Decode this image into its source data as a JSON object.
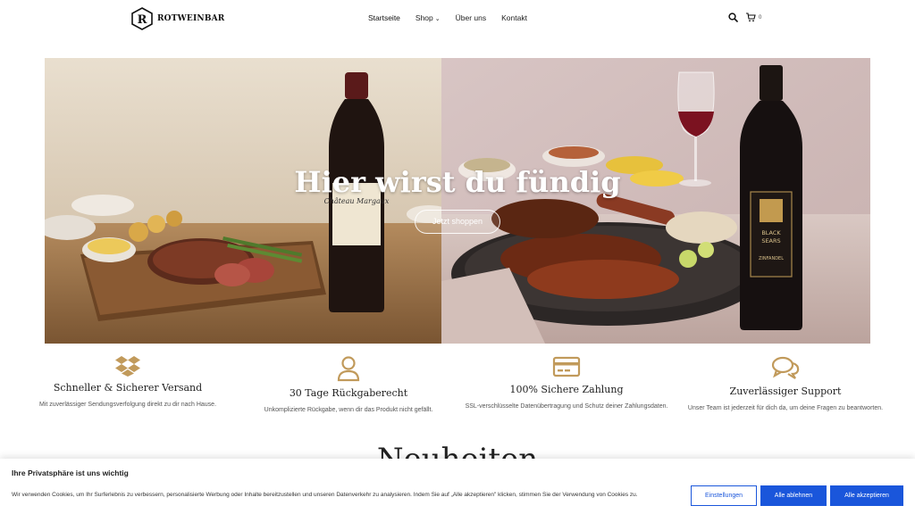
{
  "header": {
    "logo_text": "ROTWEINBAR",
    "logo_letter": "R",
    "nav": [
      {
        "label": "Startseite"
      },
      {
        "label": "Shop"
      },
      {
        "label": "Über uns"
      },
      {
        "label": "Kontakt"
      }
    ],
    "cart_count": "0",
    "icons": [
      "search-icon",
      "cart-icon",
      "chevron-down-icon"
    ]
  },
  "hero": {
    "title": "Hier wirst du fündig",
    "button_label": "Jetzt shoppen",
    "bottle_left_label": "Château Margaux",
    "bottle_right_label_line1": "BLACK",
    "bottle_right_label_line2": "SEARS",
    "bottle_right_label_line3": "ZINFANDEL"
  },
  "features": [
    {
      "icon": "dropbox-icon",
      "title": "Schneller & Sicherer Versand",
      "desc": "Mit zuverlässiger Sendungsverfolgung direkt zu dir nach Hause."
    },
    {
      "icon": "user-icon",
      "title": "30 Tage Rückgaberecht",
      "desc": "Unkomplizierte Rückgabe, wenn dir das Produkt nicht gefällt."
    },
    {
      "icon": "credit-card-icon",
      "title": "100% Sichere Zahlung",
      "desc": "SSL-verschlüsselte Datenübertragung und Schutz deiner Zahlungsdaten."
    },
    {
      "icon": "chat-icon",
      "title": "Zuverlässiger Support",
      "desc": "Unser Team ist jederzeit für dich da, um deine Fragen zu beantworten."
    }
  ],
  "section_heading": "Neuheiten",
  "cookie": {
    "title": "Ihre Privatsphäre ist uns wichtig",
    "text": "Wir verwenden Cookies, um Ihr Surferlebnis zu verbessern, personalisierte Werbung oder Inhalte bereitzustellen und unseren Datenverkehr zu analysieren. Indem Sie auf „Alle akzeptieren\" klicken, stimmen Sie der Verwendung von Cookies zu.",
    "settings_label": "Einstellungen",
    "reject_label": "Alle ablehnen",
    "accept_label": "Alle akzeptieren"
  },
  "colors": {
    "accent_gold": "#c19a5b",
    "button_blue": "#1a56db"
  }
}
